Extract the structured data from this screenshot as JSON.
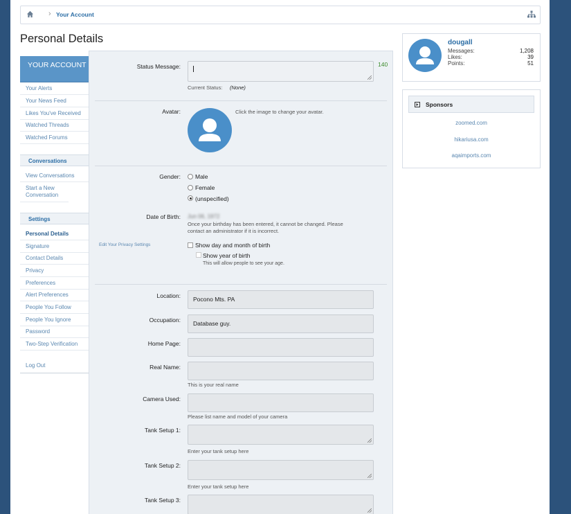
{
  "breadcrumb": {
    "link": "Your Account",
    "home_icon": "home-icon",
    "tree_icon": "sitemap-icon"
  },
  "page_title": "Personal Details",
  "nav": {
    "header": "YOUR ACCOUNT",
    "items": [
      "Your Alerts",
      "Your News Feed",
      "Likes You've Received",
      "Watched Threads",
      "Watched Forums"
    ],
    "conversations_heading": "Conversations",
    "conversations": [
      "View Conversations",
      "Start a New Conversation"
    ],
    "settings_heading": "Settings",
    "settings": [
      "Personal Details",
      "Signature",
      "Contact Details",
      "Privacy",
      "Preferences",
      "Alert Preferences",
      "People You Follow",
      "People You Ignore",
      "Password",
      "Two-Step Verification"
    ],
    "logout": "Log Out"
  },
  "form": {
    "status_label": "Status Message:",
    "status_value": "",
    "status_counter": "140",
    "current_status_label": "Current Status:",
    "current_status_value": "(None)",
    "avatar_label": "Avatar:",
    "avatar_hint": "Click the image to change your avatar.",
    "gender_label": "Gender:",
    "gender_options": [
      "Male",
      "Female",
      "(unspecified)"
    ],
    "gender_selected": "(unspecified)",
    "dob_label": "Date of Birth:",
    "dob_value": "Jun 06, 1972",
    "dob_hint_1": "Once your birthday has been entered, it cannot be changed. Please",
    "dob_hint_2": "contact an administrator if it is incorrect.",
    "privacy_link": "Edit Your Privacy Settings",
    "show_dob": "Show day and month of birth",
    "show_year": "Show year of birth",
    "show_year_hint": "This will allow people to see your age.",
    "location_label": "Location:",
    "location_value": "Pocono Mts. PA",
    "occupation_label": "Occupation:",
    "occupation_value": "Database guy.",
    "homepage_label": "Home Page:",
    "homepage_value": "",
    "realname_label": "Real Name:",
    "realname_value": "",
    "realname_hint": "This is your real name",
    "camera_label": "Camera Used:",
    "camera_value": "",
    "camera_hint": "Please list name and model of your camera",
    "tank1_label": "Tank Setup 1:",
    "tank1_hint": "Enter your tank setup here",
    "tank2_label": "Tank Setup 2:",
    "tank2_hint": "Enter your tank setup here",
    "tank3_label": "Tank Setup 3:"
  },
  "user": {
    "name": "dougall",
    "messages_label": "Messages:",
    "messages": "1,208",
    "likes_label": "Likes:",
    "likes": "39",
    "points_label": "Points:",
    "points": "51"
  },
  "sponsors": {
    "heading": "Sponsors",
    "links": [
      "zoomed.com",
      "hikariusa.com",
      "aqaimports.com"
    ]
  },
  "colors": {
    "background": "#2c527b",
    "accent": "#5a95c8",
    "link": "#2b6da5",
    "counter": "#3a8a2a"
  }
}
